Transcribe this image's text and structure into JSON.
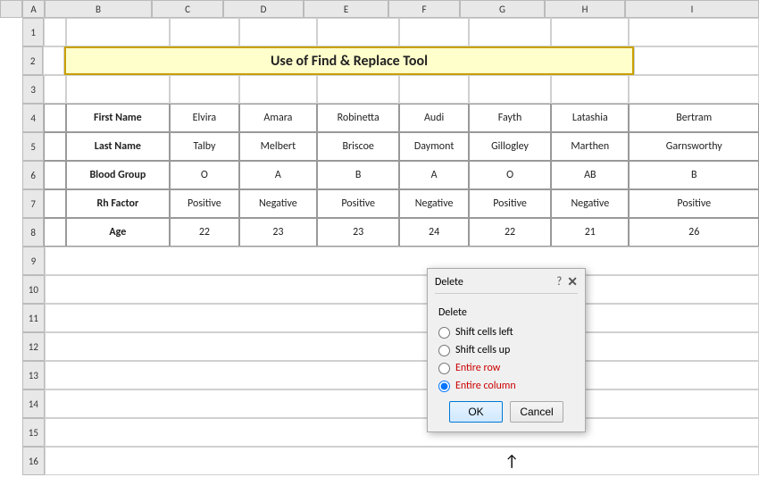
{
  "title": "Use of Find & Replace Tool",
  "columns": {
    "headers": [
      "",
      "A",
      "B",
      "C",
      "D",
      "E",
      "F",
      "G",
      "H",
      "I"
    ],
    "corner": ""
  },
  "rows": {
    "numbers": [
      "1",
      "2",
      "3",
      "4",
      "5",
      "6",
      "7",
      "8",
      "9",
      "10",
      "11",
      "12",
      "13",
      "14",
      "15",
      "16"
    ]
  },
  "table": {
    "headers": [
      "First Name",
      "Last Name",
      "Blood Group",
      "Rh Factor",
      "Age"
    ],
    "data": [
      [
        "Elvira",
        "Talby",
        "O",
        "Positive",
        "22"
      ],
      [
        "Amara",
        "Melbert",
        "A",
        "Negative",
        "23"
      ],
      [
        "Robinetta",
        "Briscoe",
        "B",
        "Positive",
        "23"
      ],
      [
        "Audi",
        "Daymont",
        "A",
        "Negative",
        "24"
      ],
      [
        "Fayth",
        "Gillogley",
        "O",
        "Positive",
        "22"
      ],
      [
        "Latashia",
        "Marthen",
        "AB",
        "Negative",
        "21"
      ],
      [
        "Bertram",
        "Garnsworthy",
        "B",
        "Positive",
        "26"
      ]
    ]
  },
  "dialog": {
    "title": "Delete",
    "section_label": "Delete",
    "help_symbol": "?",
    "close_symbol": "✕",
    "options": [
      {
        "id": "shift-left",
        "label": "Shift cells left",
        "checked": false
      },
      {
        "id": "shift-up",
        "label": "Shift cells up",
        "checked": false
      },
      {
        "id": "entire-row",
        "label": "Entire row",
        "checked": false
      },
      {
        "id": "entire-column",
        "label": "Entire column",
        "checked": true
      }
    ],
    "ok_label": "OK",
    "cancel_label": "Cancel"
  }
}
